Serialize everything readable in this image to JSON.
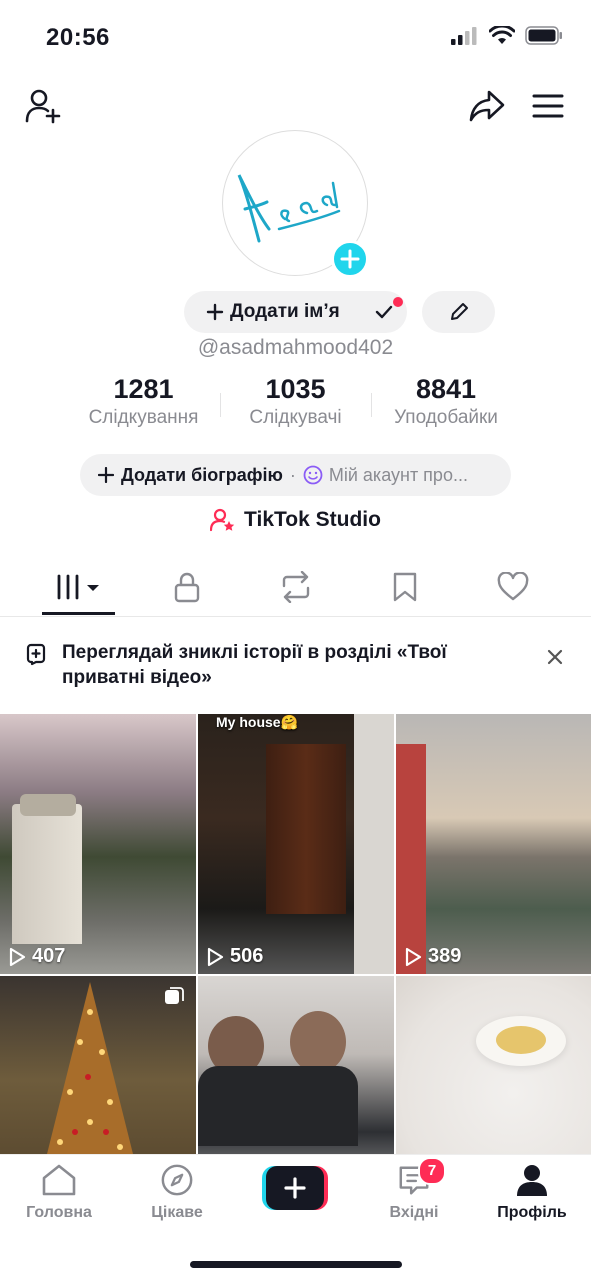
{
  "status_bar": {
    "time": "20:56"
  },
  "profile": {
    "add_name_label": "Додати ім’я",
    "username": "@asadmahmood402",
    "avatar_text": "Asad",
    "stats": [
      {
        "value": "1281",
        "label": "Слідкування"
      },
      {
        "value": "1035",
        "label": "Слідкувачі"
      },
      {
        "value": "8841",
        "label": "Уподобайки"
      }
    ],
    "add_bio_label": "Додати біографію",
    "bio_separator": "·",
    "bio_placeholder": "Мій акаунт про...",
    "studio_label": "TikTok Studio"
  },
  "tabs": [
    "videos-grid",
    "private",
    "reposts",
    "favorites",
    "liked"
  ],
  "banner": {
    "text": "Переглядай зниклі історії в розділі «Твої приватні відео»"
  },
  "videos": [
    {
      "views": "407",
      "caption": ""
    },
    {
      "views": "506",
      "caption": "My house🤗"
    },
    {
      "views": "389",
      "caption": ""
    },
    {
      "views": "",
      "caption": ""
    },
    {
      "views": "",
      "caption": ""
    },
    {
      "views": "",
      "caption": ""
    }
  ],
  "bottom_nav": {
    "home": "Головна",
    "discover": "Цікаве",
    "inbox": "Вхідні",
    "inbox_badge": "7",
    "profile": "Профіль"
  },
  "colors": {
    "accent": "#fe2c55",
    "cyan": "#20d5ec",
    "text": "#161823",
    "muted": "#8a8b91"
  }
}
